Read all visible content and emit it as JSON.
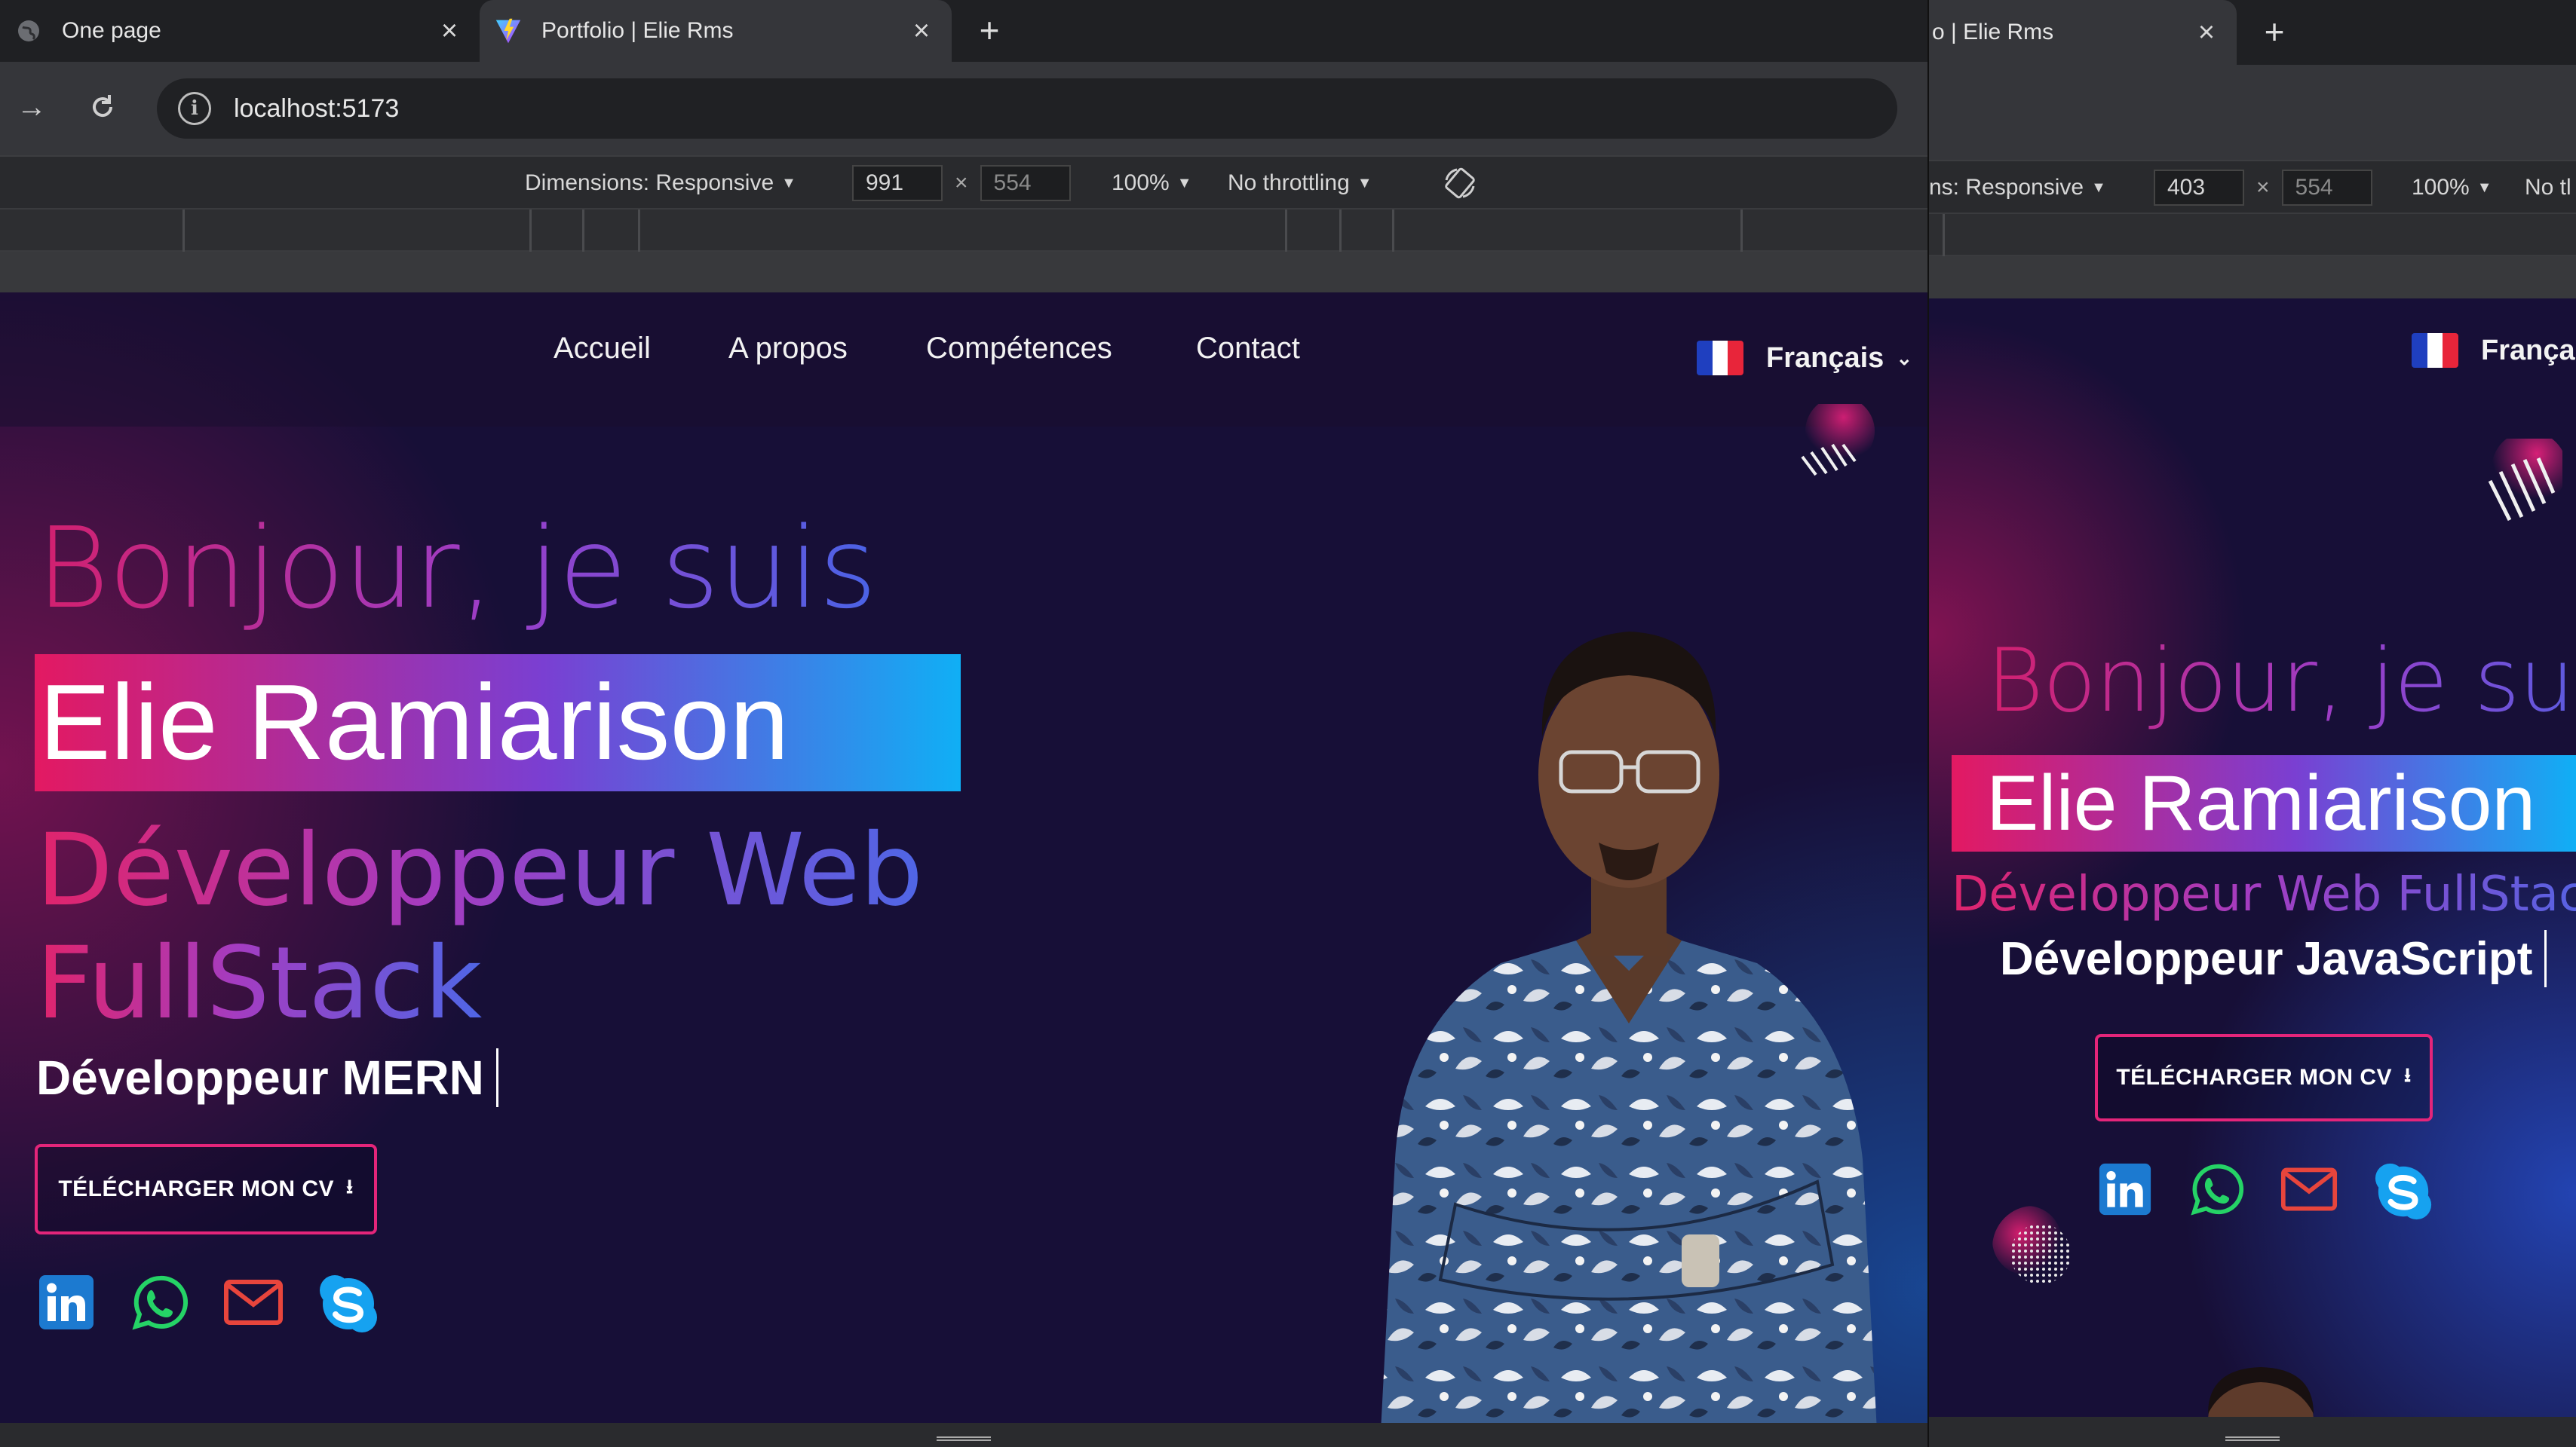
{
  "left": {
    "tabs": [
      {
        "title": "One page",
        "close": "×"
      },
      {
        "title": "Portfolio | Elie Rms",
        "close": "×"
      }
    ],
    "new_tab": "+",
    "url": "localhost:5173",
    "devtools": {
      "dimensions_label": "Dimensions: Responsive",
      "width": "991",
      "x": "×",
      "height": "554",
      "zoom": "100%",
      "throttling": "No throttling"
    },
    "nav": {
      "items": [
        "Accueil",
        "A propos",
        "Compétences",
        "Contact"
      ]
    },
    "language": "Français",
    "hero": {
      "greeting": "Bonjour, je suis",
      "name": "Elie Ramiarison",
      "role_line1": "Développeur Web",
      "role_line2": "FullStack",
      "typed": "Développeur MERN",
      "cv_button": "TÉLÉCHARGER MON CV"
    }
  },
  "right": {
    "tab": {
      "title": "o | Elie Rms",
      "close": "×"
    },
    "new_tab": "+",
    "devtools": {
      "dimensions_label": "ns: Responsive",
      "width": "403",
      "x": "×",
      "height": "554",
      "zoom": "100%",
      "throttling": "No tl"
    },
    "language": "Françai",
    "hero": {
      "greeting": "Bonjour, je suis",
      "name": "Elie Ramiarison",
      "role": "Développeur Web FullStack",
      "typed": "Développeur JavaScript",
      "cv_button": "TÉLÉCHARGER MON CV"
    }
  },
  "social_icons": [
    "linkedin-icon",
    "whatsapp-icon",
    "mail-icon",
    "skype-icon"
  ],
  "colors": {
    "background": "#170f37",
    "accent_pink": "#e31962",
    "accent_blue": "#10aff5",
    "linkedin": "#1c7ad0",
    "whatsapp": "#25d366",
    "mail": "#e8453c",
    "skype": "#16a2f0"
  }
}
